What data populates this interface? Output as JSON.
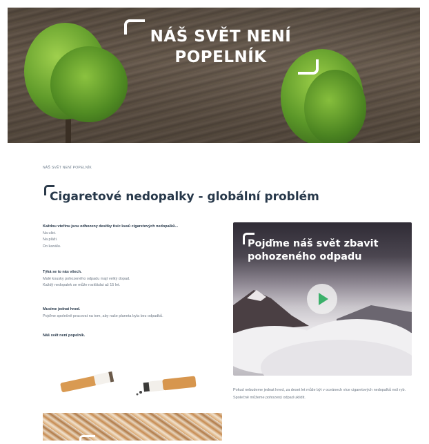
{
  "hero": {
    "title": "NÁŠ SVĚT NENÍ\nPOPELNÍK"
  },
  "breadcrumb": "NÁŠ SVĚT NENÍ POPELNÍK",
  "section": {
    "title": "Cigaretové nedopalky - globální problém"
  },
  "text_blocks": [
    {
      "heading": "Každou vteřinu jsou odhozeny desítky tisíc kusů cigaretových nedopalků...",
      "lines": [
        "Na ulici.",
        "Na pláži.",
        "Do kanálu."
      ]
    },
    {
      "heading": "Týká se to nás všech.",
      "lines": [
        "Malé kousky pohozeného odpadu mají velký dopad.",
        "Každý nedopalek se může rozkládat až 15 let."
      ]
    },
    {
      "heading": "Musíme jednat hned.",
      "lines": [
        "Pojďme společně pracovat na tom, aby naše planeta byla bez odpadků."
      ]
    },
    {
      "heading": "Náš svět není popelník.",
      "lines": []
    }
  ],
  "video": {
    "title": "Pojďme náš svět zbavit\npohozeného odpadu",
    "play_icon": "play-icon",
    "accent": "#3bb06a"
  },
  "caption": "Pokud nebudeme jednat hned, za deset let může být v oceánech více cigaretových nedopalků než ryb. Společně můžeme pohozený odpad uklidit."
}
